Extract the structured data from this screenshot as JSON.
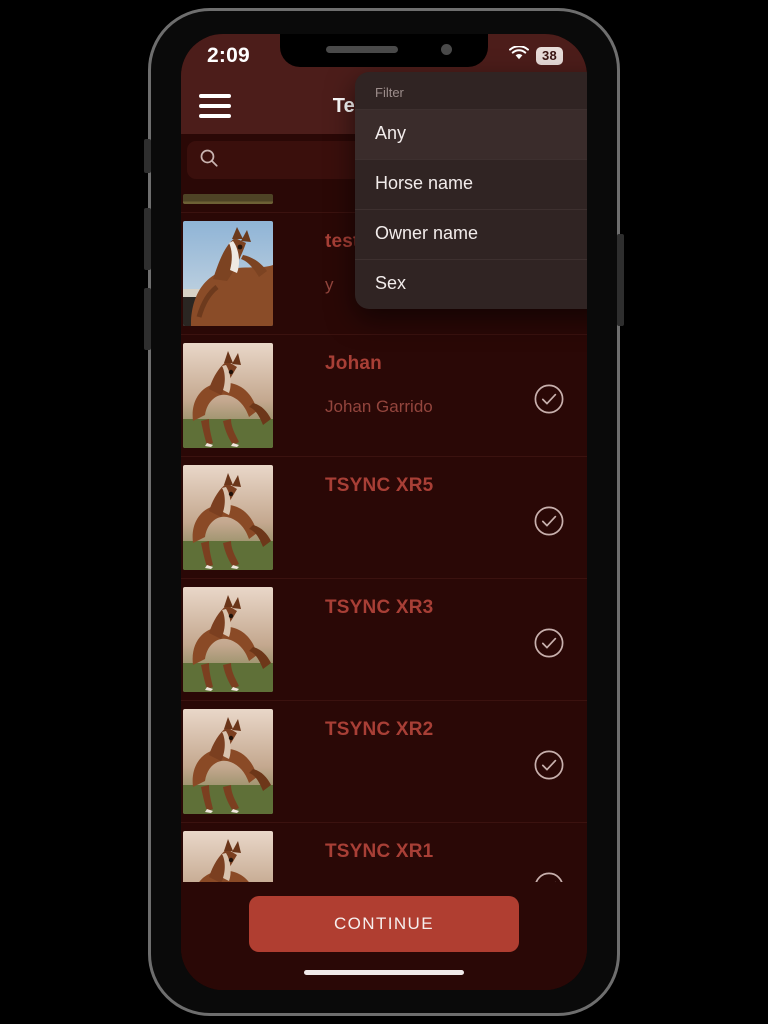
{
  "status_bar": {
    "time": "2:09",
    "wifi_icon": "wifi-icon",
    "battery_level": "38"
  },
  "app_bar": {
    "menu_icon": "hamburger-menu-icon",
    "title": "Teasing",
    "search_icon": "search-icon",
    "overflow_icon": "kebab-menu-icon"
  },
  "search": {
    "icon": "search-icon",
    "value": "",
    "placeholder": "",
    "filter_chip": {
      "icon": "filter-funnel-icon",
      "label": "Any"
    }
  },
  "filter_dropdown": {
    "header": "Filter",
    "selected": "Any",
    "items": [
      {
        "label": "Any"
      },
      {
        "label": "Horse name"
      },
      {
        "label": "Owner name"
      },
      {
        "label": "Sex"
      }
    ]
  },
  "list": {
    "rows": [
      {
        "title": "test",
        "subtitle": "y",
        "check_icon": "check-circle-icon"
      },
      {
        "title": "Johan",
        "subtitle": "Johan Garrido",
        "check_icon": "check-circle-icon"
      },
      {
        "title": "TSYNC XR5",
        "subtitle": "",
        "check_icon": "check-circle-icon"
      },
      {
        "title": "TSYNC XR3",
        "subtitle": "",
        "check_icon": "check-circle-icon"
      },
      {
        "title": "TSYNC XR2",
        "subtitle": "",
        "check_icon": "check-circle-icon"
      },
      {
        "title": "TSYNC XR1",
        "subtitle": "",
        "check_icon": "check-circle-icon"
      }
    ]
  },
  "bottom": {
    "continue_label": "CONTINUE"
  },
  "colors": {
    "app_bar": "#4c1d1a",
    "background": "#2a0806",
    "accent": "#b03e31",
    "row_title": "#a83f36",
    "menu_surface": "#302423"
  }
}
